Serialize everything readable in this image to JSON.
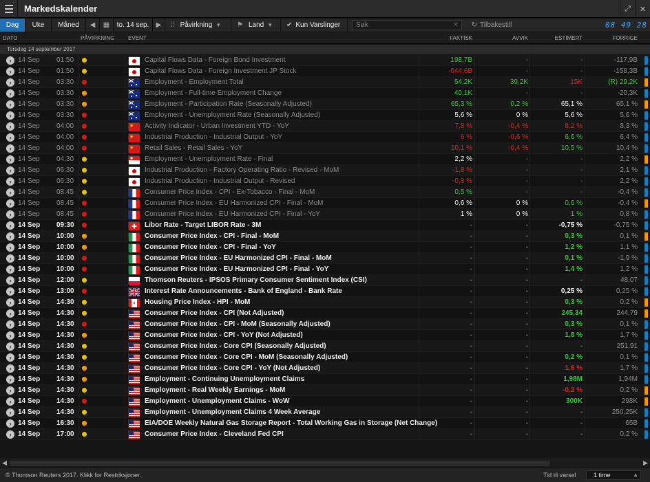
{
  "window": {
    "title": "Markedskalender"
  },
  "toolbar": {
    "tabs": [
      "Dag",
      "Uke",
      "Måned"
    ],
    "active_tab": "Dag",
    "date": "to. 14 sep.",
    "impact_filter": "Påvirkning",
    "country_filter": "Land",
    "alerts_label": "Kun Varslinger",
    "search_placeholder": "Søk",
    "reset_label": "Tilbakestill",
    "clock": "08 49 28"
  },
  "columns": {
    "date": "DATO",
    "impact": "PÅVIRKNING",
    "event": "EVENT",
    "actual": "FAKTISK",
    "deviation": "AVVIK",
    "estimate": "ESTIMERT",
    "previous": "FORRIGE"
  },
  "date_group": "Torsdag 14 september 2017",
  "colors": {
    "impact_low": "#e8c400",
    "impact_med": "#e89a00",
    "impact_high": "#d01818",
    "positive": "#2ecc2e",
    "negative": "#e02020",
    "accent": "#1d6fb8"
  },
  "rows": [
    {
      "date": "14 Sep",
      "time": "01:50",
      "impact": 1,
      "flag": "JP",
      "event": "Capital Flows Data - Foreign Bond Investment",
      "actual": "198,7B",
      "actual_s": "pos",
      "dev": "-",
      "dev_s": "dim",
      "est": "-",
      "est_s": "dim",
      "prev": "-117,9B",
      "state": "past"
    },
    {
      "date": "14 Sep",
      "time": "01:50",
      "impact": 1,
      "flag": "JP",
      "event": "Capital Flows Data - Foreign Investment JP Stock",
      "actual": "-644,6B",
      "actual_s": "neg",
      "dev": "-",
      "dev_s": "dim",
      "est": "-",
      "est_s": "dim",
      "prev": "-158,3B",
      "state": "past"
    },
    {
      "date": "14 Sep",
      "time": "03:30",
      "impact": 3,
      "flag": "AU",
      "event": "Employment - Employment Total",
      "actual": "54,2K",
      "actual_s": "pos",
      "dev": "39,2K",
      "dev_s": "pos",
      "est": "15K",
      "est_s": "neg",
      "prev": "(R) 29,2K",
      "prev_s": "pos",
      "state": "past"
    },
    {
      "date": "14 Sep",
      "time": "03:30",
      "impact": 2,
      "flag": "AU",
      "event": "Employment - Full-time Employment Change",
      "actual": "40,1K",
      "actual_s": "pos",
      "dev": "-",
      "dev_s": "dim",
      "est": "-",
      "est_s": "dim",
      "prev": "-20,3K",
      "state": "past"
    },
    {
      "date": "14 Sep",
      "time": "03:30",
      "impact": 2,
      "flag": "AU",
      "event": "Employment - Participation Rate (Seasonally Adjusted)",
      "actual": "65,3 %",
      "actual_s": "pos",
      "dev": "0,2 %",
      "dev_s": "pos",
      "est": "65,1 %",
      "est_s": "neu",
      "prev": "65,1 %",
      "state": "past"
    },
    {
      "date": "14 Sep",
      "time": "03:30",
      "impact": 3,
      "flag": "AU",
      "event": "Employment - Unemployment Rate (Seasonally Adjusted)",
      "actual": "5,6 %",
      "actual_s": "neu",
      "dev": "0 %",
      "dev_s": "neu",
      "est": "5,6 %",
      "est_s": "neu",
      "prev": "5,6 %",
      "state": "past"
    },
    {
      "date": "14 Sep",
      "time": "04:00",
      "impact": 3,
      "flag": "CN",
      "event": "Activity Indicator - Urban Investment YTD - YoY",
      "actual": "7,8 %",
      "actual_s": "neg",
      "dev": "-0,4 %",
      "dev_s": "neg",
      "est": "8,2 %",
      "est_s": "neg",
      "prev": "8,3 %",
      "state": "past"
    },
    {
      "date": "14 Sep",
      "time": "04:00",
      "impact": 3,
      "flag": "CN",
      "event": "Industrial Production - Industrial Output - YoY",
      "actual": "6 %",
      "actual_s": "neg",
      "dev": "-0,6 %",
      "dev_s": "neg",
      "est": "6,6 %",
      "est_s": "pos",
      "prev": "6,4 %",
      "state": "past"
    },
    {
      "date": "14 Sep",
      "time": "04:00",
      "impact": 3,
      "flag": "CN",
      "event": "Retail Sales - Retail Sales - YoY",
      "actual": "10,1 %",
      "actual_s": "neg",
      "dev": "-0,4 %",
      "dev_s": "neg",
      "est": "10,5 %",
      "est_s": "pos",
      "prev": "10,4 %",
      "state": "past"
    },
    {
      "date": "14 Sep",
      "time": "04:30",
      "impact": 1,
      "flag": "SG",
      "event": "Employment - Unemployment Rate - Final",
      "actual": "2,2 %",
      "actual_s": "neu",
      "dev": "-",
      "dev_s": "dim",
      "est": "-",
      "est_s": "dim",
      "prev": "2,2 %",
      "state": "past"
    },
    {
      "date": "14 Sep",
      "time": "06:30",
      "impact": 1,
      "flag": "JP",
      "event": "Industrial Production - Factory Operating Ratio - Revised - MoM",
      "actual": "-1,8 %",
      "actual_s": "neg",
      "dev": "-",
      "dev_s": "dim",
      "est": "-",
      "est_s": "dim",
      "prev": "2,1 %",
      "state": "past"
    },
    {
      "date": "14 Sep",
      "time": "06:30",
      "impact": 1,
      "flag": "JP",
      "event": "Industrial Production - Industrial Output - Revised",
      "actual": "-0,8 %",
      "actual_s": "neg",
      "dev": "-",
      "dev_s": "dim",
      "est": "-",
      "est_s": "dim",
      "prev": "2,2 %",
      "state": "past"
    },
    {
      "date": "14 Sep",
      "time": "08:45",
      "impact": 1,
      "flag": "FR",
      "event": "Consumer Price Index - CPI - Ex-Tobacco - Final - MoM",
      "actual": "0,5 %",
      "actual_s": "pos",
      "dev": "-",
      "dev_s": "dim",
      "est": "-",
      "est_s": "dim",
      "prev": "-0,4 %",
      "state": "past"
    },
    {
      "date": "14 Sep",
      "time": "08:45",
      "impact": 3,
      "flag": "FR",
      "event": "Consumer Price Index - EU Harmonized CPI - Final - MoM",
      "actual": "0,6 %",
      "actual_s": "neu",
      "dev": "0 %",
      "dev_s": "neu",
      "est": "0,6 %",
      "est_s": "pos",
      "prev": "-0,4 %",
      "state": "past"
    },
    {
      "date": "14 Sep",
      "time": "08:45",
      "impact": 3,
      "flag": "FR",
      "event": "Consumer Price Index - EU Harmonized CPI - Final - YoY",
      "actual": "1 %",
      "actual_s": "neu",
      "dev": "0 %",
      "dev_s": "neu",
      "est": "1 %",
      "est_s": "pos",
      "prev": "0,8 %",
      "state": "past"
    },
    {
      "date": "14 Sep",
      "time": "09:30",
      "impact": 3,
      "flag": "CH",
      "event": "Libor Rate - Target LIBOR Rate - 3M",
      "actual": "-",
      "actual_s": "dim",
      "dev": "-",
      "dev_s": "dim",
      "est": "-0,75 %",
      "est_s": "neu",
      "prev": "-0,75 %",
      "state": "future"
    },
    {
      "date": "14 Sep",
      "time": "10:00",
      "impact": 2,
      "flag": "IT",
      "event": "Consumer Price Index - CPI - Final - MoM",
      "actual": "-",
      "actual_s": "dim",
      "dev": "-",
      "dev_s": "dim",
      "est": "0,3 %",
      "est_s": "pos",
      "prev": "0,1 %",
      "state": "future"
    },
    {
      "date": "14 Sep",
      "time": "10:00",
      "impact": 2,
      "flag": "IT",
      "event": "Consumer Price Index - CPI - Final - YoY",
      "actual": "-",
      "actual_s": "dim",
      "dev": "-",
      "dev_s": "dim",
      "est": "1,2 %",
      "est_s": "pos",
      "prev": "1,1 %",
      "state": "future"
    },
    {
      "date": "14 Sep",
      "time": "10:00",
      "impact": 3,
      "flag": "IT",
      "event": "Consumer Price Index - EU Harmonized CPI - Final - MoM",
      "actual": "-",
      "actual_s": "dim",
      "dev": "-",
      "dev_s": "dim",
      "est": "0,1 %",
      "est_s": "pos",
      "prev": "-1,9 %",
      "state": "future"
    },
    {
      "date": "14 Sep",
      "time": "10:00",
      "impact": 3,
      "flag": "IT",
      "event": "Consumer Price Index - EU Harmonized CPI - Final - YoY",
      "actual": "-",
      "actual_s": "dim",
      "dev": "-",
      "dev_s": "dim",
      "est": "1,4 %",
      "est_s": "pos",
      "prev": "1,2 %",
      "state": "future"
    },
    {
      "date": "14 Sep",
      "time": "12:00",
      "impact": 1,
      "flag": "PL",
      "event": "Thomson Reuters - IPSOS Primary Consumer Sentiment Index (CSI)",
      "actual": "-",
      "actual_s": "dim",
      "dev": "-",
      "dev_s": "dim",
      "est": "-",
      "est_s": "dim",
      "prev": "48,07",
      "state": "future"
    },
    {
      "date": "14 Sep",
      "time": "13:00",
      "impact": 3,
      "flag": "GB",
      "event": "Interest Rate Announcements - Bank of England - Bank Rate",
      "actual": "-",
      "actual_s": "dim",
      "dev": "-",
      "dev_s": "dim",
      "est": "0,25 %",
      "est_s": "neu",
      "prev": "0,25 %",
      "state": "future"
    },
    {
      "date": "14 Sep",
      "time": "14:30",
      "impact": 1,
      "flag": "CA",
      "event": "Housing Price Index - HPI - MoM",
      "actual": "-",
      "actual_s": "dim",
      "dev": "-",
      "dev_s": "dim",
      "est": "0,3 %",
      "est_s": "pos",
      "prev": "0,2 %",
      "state": "future"
    },
    {
      "date": "14 Sep",
      "time": "14:30",
      "impact": 1,
      "flag": "US",
      "event": "Consumer Price Index - CPI (Not Adjusted)",
      "actual": "-",
      "actual_s": "dim",
      "dev": "-",
      "dev_s": "dim",
      "est": "245,34",
      "est_s": "pos",
      "prev": "244,79",
      "state": "future"
    },
    {
      "date": "14 Sep",
      "time": "14:30",
      "impact": 3,
      "flag": "US",
      "event": "Consumer Price Index - CPI - MoM (Seasonally Adjusted)",
      "actual": "-",
      "actual_s": "dim",
      "dev": "-",
      "dev_s": "dim",
      "est": "0,3 %",
      "est_s": "pos",
      "prev": "0,1 %",
      "state": "future"
    },
    {
      "date": "14 Sep",
      "time": "14:30",
      "impact": 2,
      "flag": "US",
      "event": "Consumer Price Index - CPI - YoY (Not Adjusted)",
      "actual": "-",
      "actual_s": "dim",
      "dev": "-",
      "dev_s": "dim",
      "est": "1,8 %",
      "est_s": "pos",
      "prev": "1,7 %",
      "state": "future"
    },
    {
      "date": "14 Sep",
      "time": "14:30",
      "impact": 1,
      "flag": "US",
      "event": "Consumer Price Index - Core CPI (Seasonally Adjusted)",
      "actual": "-",
      "actual_s": "dim",
      "dev": "-",
      "dev_s": "dim",
      "est": "-",
      "est_s": "dim",
      "prev": "251,91",
      "state": "future"
    },
    {
      "date": "14 Sep",
      "time": "14:30",
      "impact": 1,
      "flag": "US",
      "event": "Consumer Price Index - Core CPI - MoM (Seasonally Adjusted)",
      "actual": "-",
      "actual_s": "dim",
      "dev": "-",
      "dev_s": "dim",
      "est": "0,2 %",
      "est_s": "pos",
      "prev": "0,1 %",
      "state": "future"
    },
    {
      "date": "14 Sep",
      "time": "14:30",
      "impact": 2,
      "flag": "US",
      "event": "Consumer Price Index - Core CPI - YoY (Not Adjusted)",
      "actual": "-",
      "actual_s": "dim",
      "dev": "-",
      "dev_s": "dim",
      "est": "1,6 %",
      "est_s": "neg",
      "prev": "1,7 %",
      "state": "future"
    },
    {
      "date": "14 Sep",
      "time": "14:30",
      "impact": 2,
      "flag": "US",
      "event": "Employment - Continuing Unemployment Claims",
      "actual": "-",
      "actual_s": "dim",
      "dev": "-",
      "dev_s": "dim",
      "est": "1,98M",
      "est_s": "pos",
      "prev": "1,94M",
      "state": "future"
    },
    {
      "date": "14 Sep",
      "time": "14:30",
      "impact": 1,
      "flag": "US",
      "event": "Employment - Real Weekly Earnings - MoM",
      "actual": "-",
      "actual_s": "dim",
      "dev": "-",
      "dev_s": "dim",
      "est": "-0,2 %",
      "est_s": "neg",
      "prev": "0,2 %",
      "state": "future"
    },
    {
      "date": "14 Sep",
      "time": "14:30",
      "impact": 3,
      "flag": "US",
      "event": "Employment - Unemployment Claims - WoW",
      "actual": "-",
      "actual_s": "dim",
      "dev": "-",
      "dev_s": "dim",
      "est": "300K",
      "est_s": "pos",
      "prev": "298K",
      "state": "future"
    },
    {
      "date": "14 Sep",
      "time": "14:30",
      "impact": 1,
      "flag": "US",
      "event": "Employment - Unemployment Claims 4 Week Average",
      "actual": "-",
      "actual_s": "dim",
      "dev": "-",
      "dev_s": "dim",
      "est": "-",
      "est_s": "dim",
      "prev": "250,25K",
      "state": "future"
    },
    {
      "date": "14 Sep",
      "time": "16:30",
      "impact": 2,
      "flag": "US",
      "event": "EIA/DOE Weekly Natural Gas Storage Report - Total Working Gas in Storage (Net Change)",
      "actual": "-",
      "actual_s": "dim",
      "dev": "-",
      "dev_s": "dim",
      "est": "-",
      "est_s": "dim",
      "prev": "65B",
      "state": "future"
    },
    {
      "date": "14 Sep",
      "time": "17:00",
      "impact": 1,
      "flag": "US",
      "event": "Consumer Price Index - Cleveland Fed CPI",
      "actual": "-",
      "actual_s": "dim",
      "dev": "-",
      "dev_s": "dim",
      "est": "-",
      "est_s": "dim",
      "prev": "0,2 %",
      "state": "future"
    }
  ],
  "footer": {
    "copyright": "© Thomson Reuters 2017. Klikk for Restriksjoner.",
    "alert_time_label": "Tid til varsel",
    "alert_time_value": "1 time"
  }
}
